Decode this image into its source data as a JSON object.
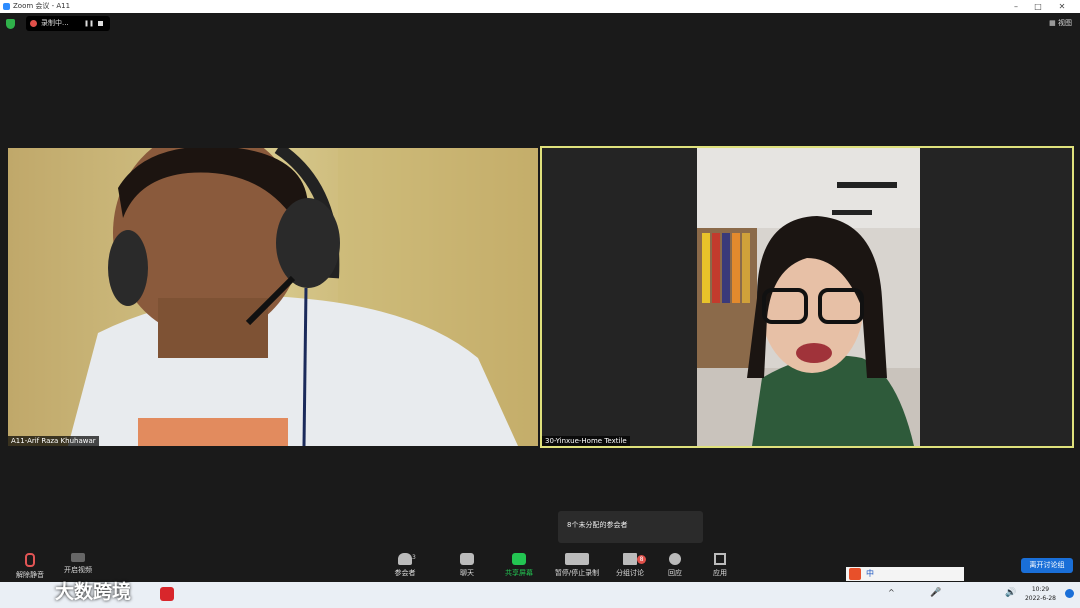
{
  "window": {
    "title": "Zoom 会议 - A11"
  },
  "recording": {
    "label": "录制中...",
    "pause_glyph": "❚❚"
  },
  "view_button": {
    "label": "视图"
  },
  "participants": [
    {
      "name": "A11-Arif Raza Khuhawar"
    },
    {
      "name": "30-Yinxue-Home Textile"
    }
  ],
  "popup": {
    "text": "8个未分配的参会者"
  },
  "toolbar": {
    "mute": "解除静音",
    "video": "开启视频",
    "participants": "参会者",
    "participants_count": "3",
    "chat": "聊天",
    "share": "共享屏幕",
    "record": "暂停/停止录制",
    "breakout": "分组讨论",
    "breakout_badge": "8",
    "reactions": "回应",
    "apps": "应用",
    "leave": "离开讨论组"
  },
  "ime": {
    "label": "中"
  },
  "watermark": {
    "text": "大数跨境"
  },
  "taskbar": {
    "time": "10:29",
    "date": "2022-6-28"
  },
  "colors": {
    "accent": "#2d8cff",
    "share_green": "#23c552",
    "active_border": "#dfe17c",
    "leave_blue": "#1a6fd8"
  }
}
